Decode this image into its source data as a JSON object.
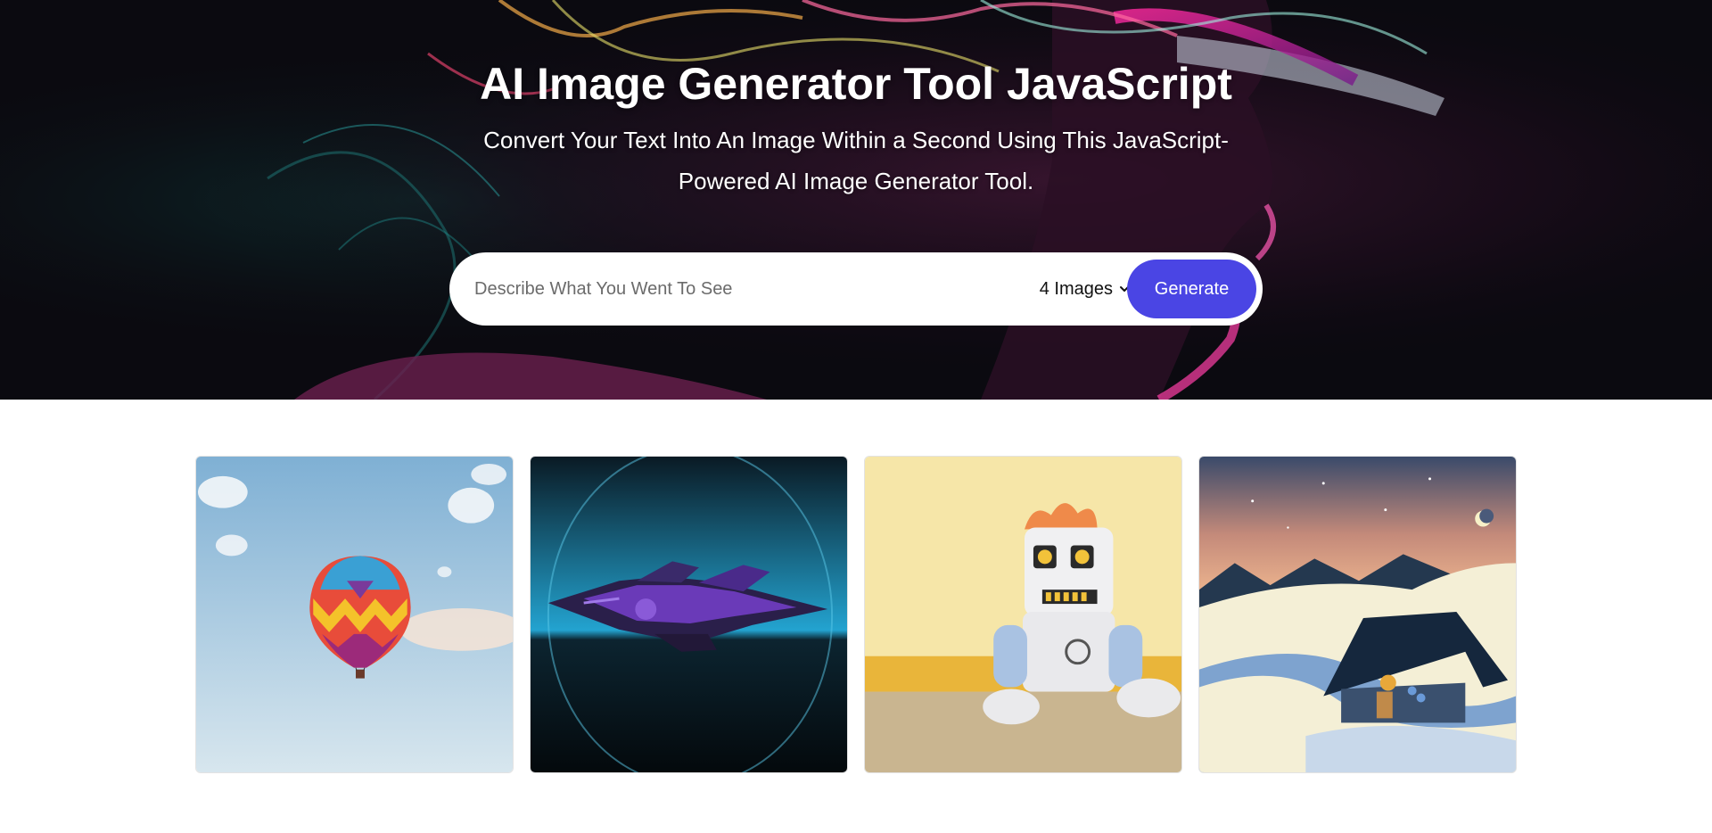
{
  "hero": {
    "title": "AI Image Generator Tool JavaScript",
    "subtitle": "Convert Your Text Into An Image Within a Second Using This JavaScript-Powered AI Image Generator Tool."
  },
  "search": {
    "placeholder": "Describe What You Went To See",
    "value": "",
    "count_selected": "4 Images",
    "generate_label": "Generate"
  },
  "gallery": {
    "images": [
      {
        "icon": "hot-air-balloon-image"
      },
      {
        "icon": "spaceship-image"
      },
      {
        "icon": "robot-toy-image"
      },
      {
        "icon": "snowy-house-image"
      }
    ]
  },
  "colors": {
    "accent": "#4a45e4",
    "hero_bg": "#0b0a10"
  }
}
